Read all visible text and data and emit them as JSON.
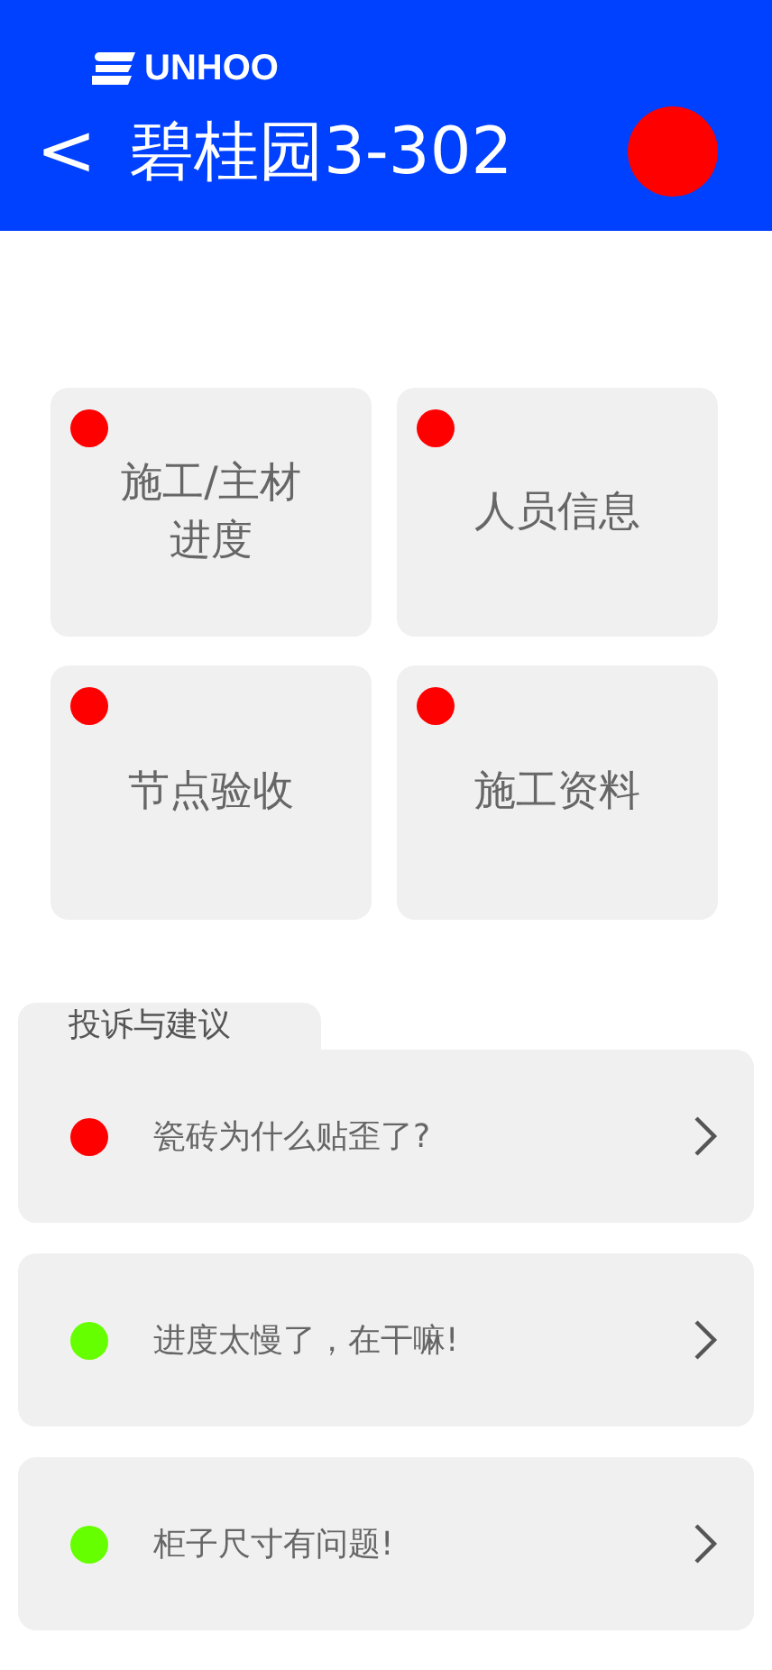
{
  "header": {
    "logo_text": "UNHOO",
    "back_icon": "<",
    "title": "碧桂园3-302"
  },
  "tiles": [
    {
      "label": "施工/主材进度"
    },
    {
      "label": "人员信息"
    },
    {
      "label": "节点验收"
    },
    {
      "label": "施工资料"
    }
  ],
  "feedback": {
    "title": "投诉与建议",
    "items": [
      {
        "text": "瓷砖为什么贴歪了?",
        "color": "#ff0000"
      },
      {
        "text": "进度太慢了，在干嘛!",
        "color": "#66ff00"
      },
      {
        "text": "柜子尺寸有问题!",
        "color": "#66ff00"
      }
    ]
  }
}
